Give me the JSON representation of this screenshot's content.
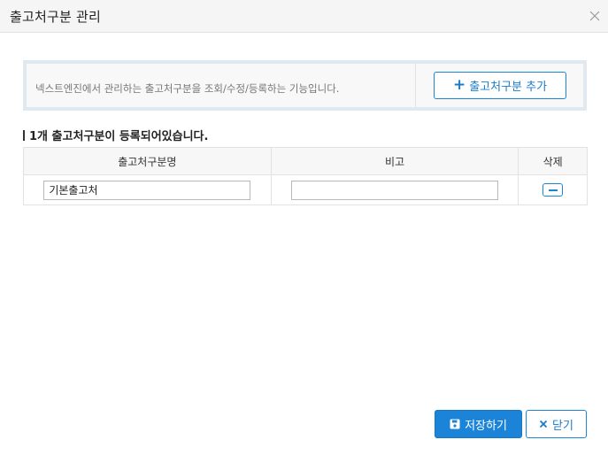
{
  "dialog": {
    "title": "출고처구분 관리"
  },
  "info": {
    "description": "넥스트엔진에서 관리하는 출고처구분을 조회/수정/등록하는 기능입니다.",
    "add_button_label": "출고처구분 추가"
  },
  "summary": {
    "count_text": "1개 출고처구분이 등록되어있습니다."
  },
  "table": {
    "headers": {
      "name": "출고처구분명",
      "note": "비고",
      "delete": "삭제"
    },
    "rows": [
      {
        "name": "기본출고처",
        "note": ""
      }
    ]
  },
  "footer": {
    "save_label": "저장하기",
    "close_label": "닫기"
  },
  "colors": {
    "accent": "#1b84d8",
    "info_border": "#dfe9ef"
  },
  "icons": {
    "close": "close-x-icon",
    "add": "plus-icon",
    "delete": "minus-icon",
    "save": "floppy-disk-icon",
    "close_button": "x-icon"
  }
}
